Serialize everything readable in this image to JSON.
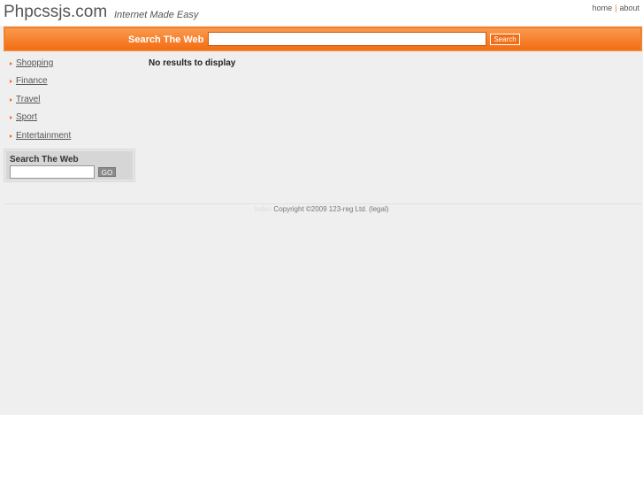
{
  "header": {
    "site_title": "Phpcssjs.com",
    "tagline": "Internet Made Easy",
    "links": {
      "home": "home",
      "separator": "|",
      "about": "about"
    }
  },
  "search_bar": {
    "label": "Search The Web",
    "input_value": "",
    "button_label": "Search"
  },
  "sidebar": {
    "items": [
      {
        "label": "Shopping"
      },
      {
        "label": "Finance"
      },
      {
        "label": "Travel"
      },
      {
        "label": "Sport"
      },
      {
        "label": "Entertainment"
      }
    ],
    "search": {
      "label": "Search The Web",
      "input_value": "",
      "button_label": "GO"
    }
  },
  "main": {
    "message": "No results to display"
  },
  "footer": {
    "faint_text": "Index",
    "copyright": "Copyright ©2009 123-reg Ltd. (legal)"
  },
  "colors": {
    "accent": "#f57a1e",
    "page_background": "#efefef"
  }
}
